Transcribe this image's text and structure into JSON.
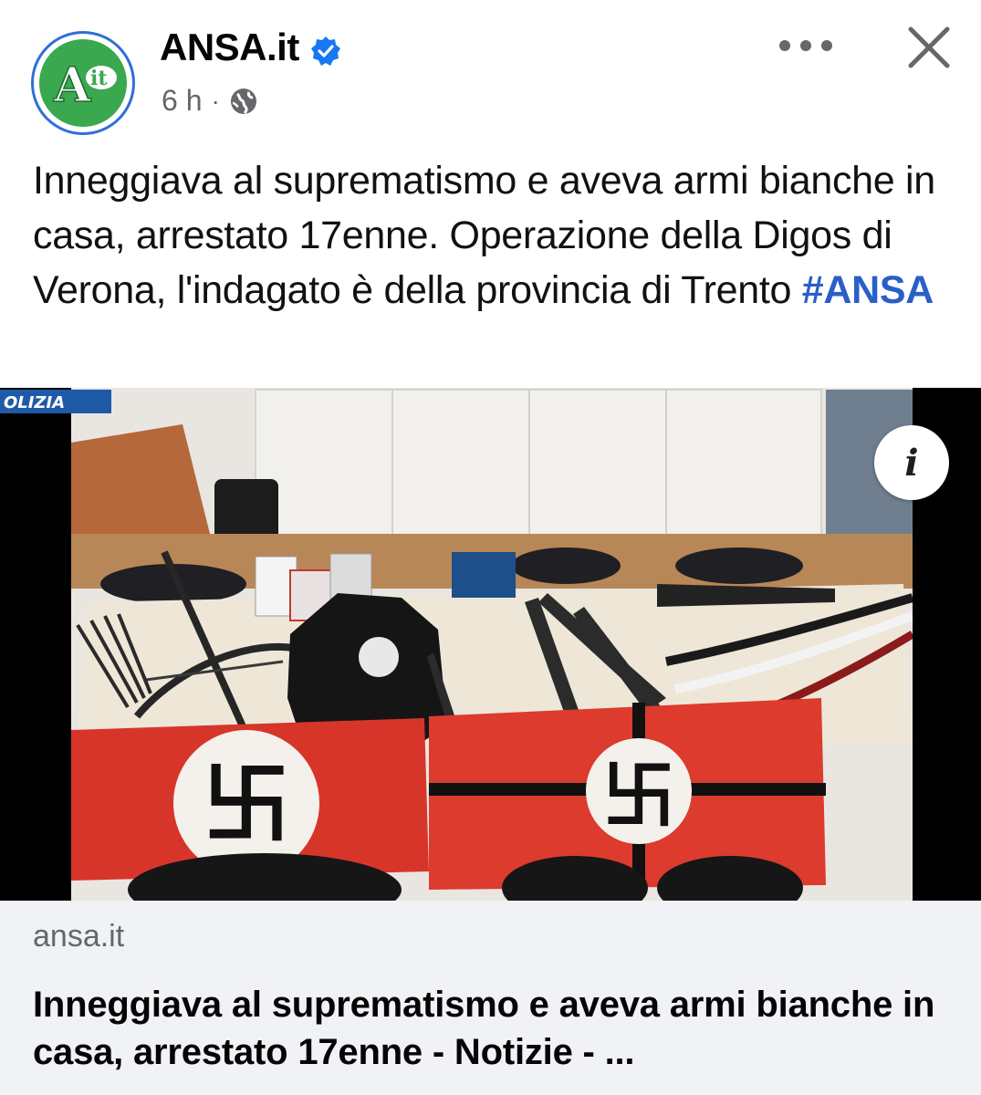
{
  "header": {
    "page_name": "ANSA.it",
    "avatar_logo_text": "A it",
    "timestamp": "6 h",
    "separator": "·",
    "audience_icon": "globe-icon",
    "verified_icon": "verified-badge-icon",
    "more_icon": "more-options-icon",
    "close_icon": "close-icon"
  },
  "post": {
    "caption_text": "Inneggiava al suprematismo e aveva armi bianche in casa, arrestato 17enne. Operazione della Digos di Verona, l'indagato è della provincia di Trento",
    "hashtag": "#ANSA"
  },
  "media": {
    "watermark": "OLIZIA",
    "info_icon_glyph": "i"
  },
  "link_preview": {
    "domain": "ansa.it",
    "title": "Inneggiava al suprematismo e aveva armi bianche in casa, arrestato 17enne - Notizie - ..."
  },
  "colors": {
    "hashtag": "#2a5fc7",
    "verified": "#1877f2",
    "secondary_text": "#65676b",
    "preview_bg": "#f0f2f5",
    "logo_green": "#3aa84f"
  }
}
